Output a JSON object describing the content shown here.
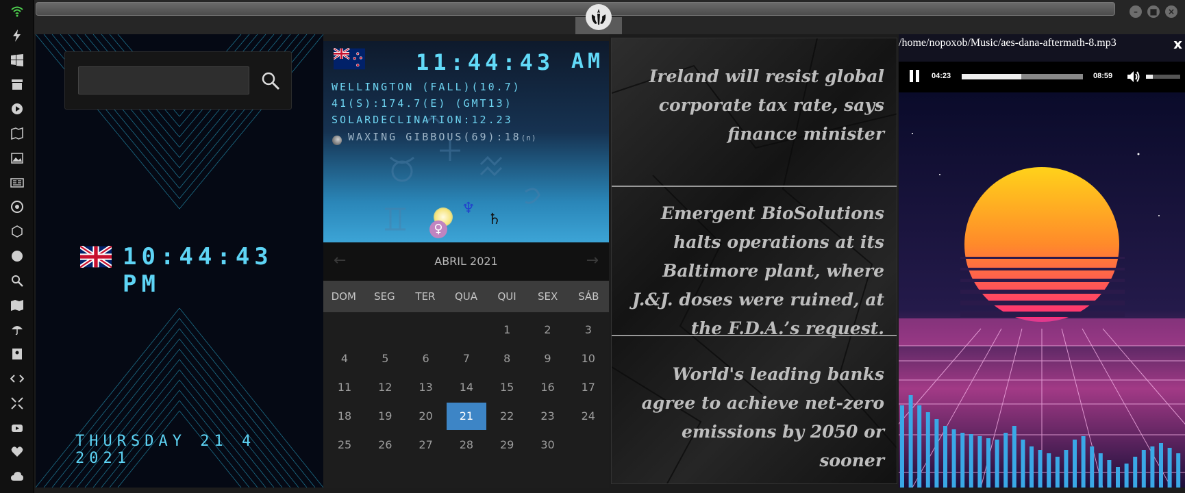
{
  "dock": {
    "icons": [
      "wifi-icon",
      "bolt-icon",
      "windows-icon",
      "archive-icon",
      "play-icon",
      "map-book-icon",
      "image-icon",
      "news-icon",
      "aperture-icon",
      "hexagon-icon",
      "globe-icon",
      "search-icon",
      "map-icon",
      "umbrella-icon",
      "contacts-icon",
      "code-icon",
      "expand-icon",
      "youtube-icon",
      "heart-icon",
      "cloud-icon"
    ]
  },
  "titlebar": {
    "logo": "rebel-alliance-icon"
  },
  "world_clock": {
    "search": {
      "value": "",
      "placeholder": ""
    },
    "time": "10:44:43 PM",
    "date": "THURSDAY 21 4 2021"
  },
  "astro": {
    "time": "11:44:43",
    "ampm": "AM",
    "line1": "WELLINGTON (FALL)(10.7)",
    "line2": "41(S):174.7(E) (GMT13)",
    "line3": "SOLARDECLINATION:12.23",
    "moon": "WAXING GIBBOUS(69):18",
    "moon_suffix": "(n)",
    "planets": {
      "neptune": "♆",
      "saturn": "♄",
      "venus": "♀"
    }
  },
  "calendar": {
    "month": "ABRIL 2021",
    "prev": "←",
    "next": "→",
    "weekdays": [
      "DOM",
      "SEG",
      "TER",
      "QUA",
      "QUI",
      "SEX",
      "SÁB"
    ],
    "weeks": [
      [
        "",
        "",
        "",
        "",
        "1",
        "2",
        "3"
      ],
      [
        "4",
        "5",
        "6",
        "7",
        "8",
        "9",
        "10"
      ],
      [
        "11",
        "12",
        "13",
        "14",
        "15",
        "16",
        "17"
      ],
      [
        "18",
        "19",
        "20",
        "21",
        "22",
        "23",
        "24"
      ],
      [
        "25",
        "26",
        "27",
        "28",
        "29",
        "30",
        ""
      ]
    ],
    "today": "21"
  },
  "news": {
    "items": [
      "Ireland will resist global corporate tax rate, says finance minister",
      "Emergent BioSolutions halts operations at its Baltimore plant, where J.&J. doses were ruined, at the F.D.A.’s request.",
      "World's leading banks agree to achieve net-zero emissions by 2050 or sooner"
    ]
  },
  "player": {
    "path": "/home/nopoxob/Music/aes-dana-aftermath-8.mp3",
    "close": "x",
    "current_time": "04:23",
    "duration": "08:59",
    "progress": 0.49,
    "volume": 0.2
  }
}
